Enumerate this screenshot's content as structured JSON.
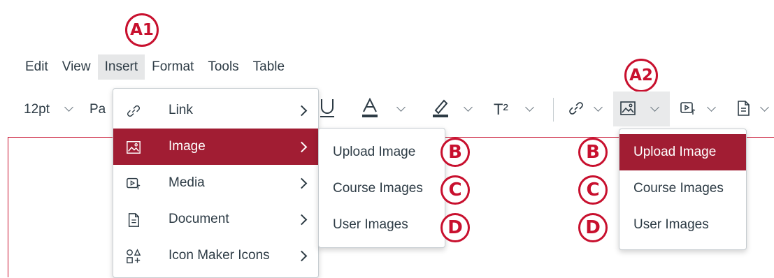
{
  "callouts": {
    "a1": "A1",
    "a2": "A2",
    "b": "B",
    "c": "C",
    "d": "D"
  },
  "menubar": {
    "items": [
      "Edit",
      "View",
      "Insert",
      "Format",
      "Tools",
      "Table"
    ],
    "active": "Insert"
  },
  "toolbar": {
    "font_size": "12pt",
    "paragraph_partial": "Pa",
    "superscript_label": "T²"
  },
  "insert_menu": {
    "items": [
      {
        "label": "Link",
        "icon": "link-icon",
        "has_submenu": true
      },
      {
        "label": "Image",
        "icon": "image-icon",
        "has_submenu": true,
        "selected": true
      },
      {
        "label": "Media",
        "icon": "media-icon",
        "has_submenu": true
      },
      {
        "label": "Document",
        "icon": "document-icon",
        "has_submenu": true
      },
      {
        "label": "Icon Maker Icons",
        "icon": "icon-maker-icon",
        "has_submenu": true
      }
    ]
  },
  "image_submenu": {
    "items": [
      "Upload Image",
      "Course Images",
      "User Images"
    ]
  },
  "toolbar_image_menu": {
    "items": [
      "Upload Image",
      "Course Images",
      "User Images"
    ],
    "selected": "Upload Image"
  },
  "colors": {
    "accent": "#a11d33",
    "callout": "#c8102e",
    "text": "#2d3b45"
  }
}
